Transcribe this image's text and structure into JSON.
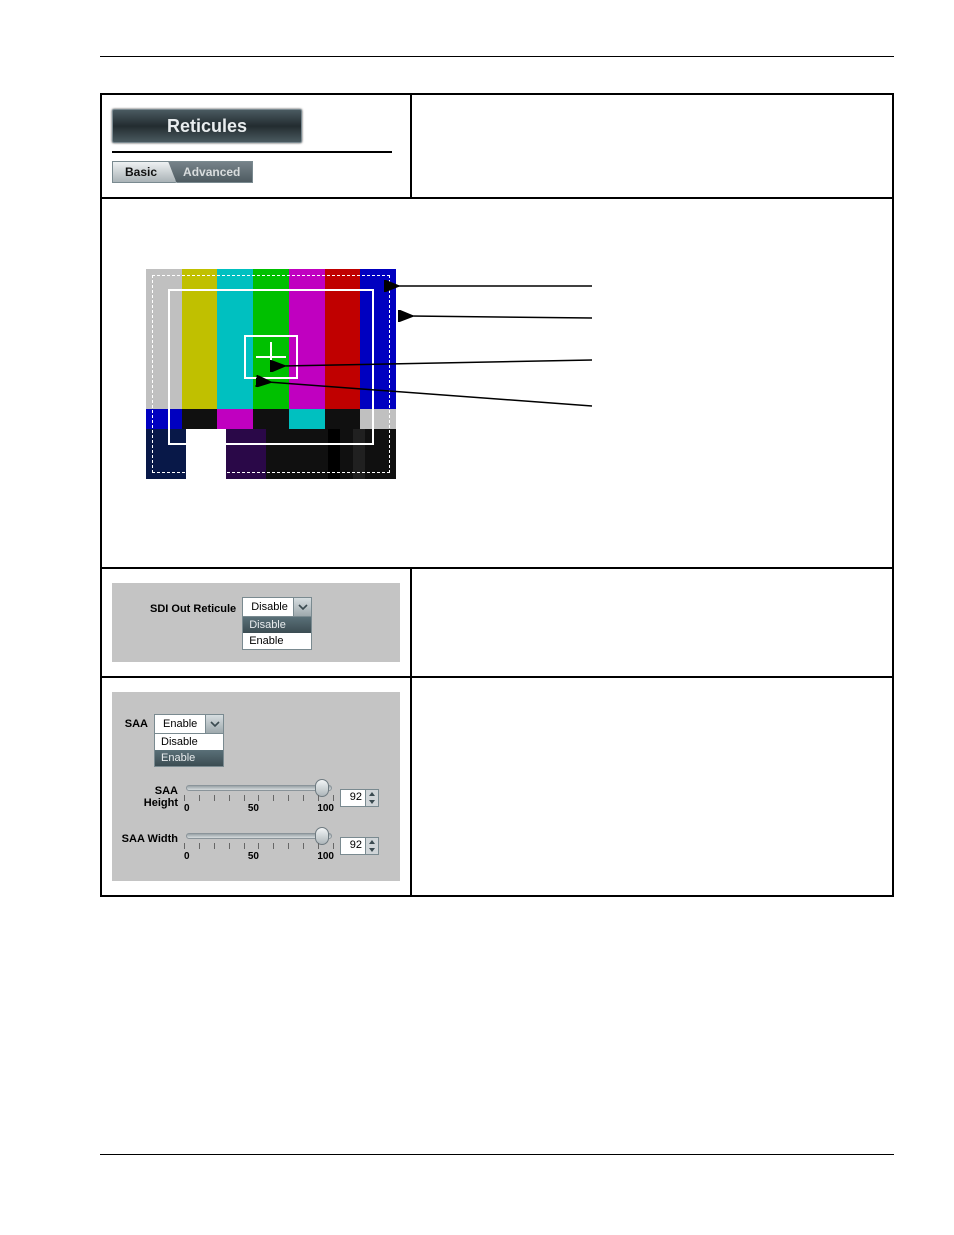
{
  "row1": {
    "title": "Reticules",
    "tab_basic": "Basic",
    "tab_advanced": "Advanced"
  },
  "row3": {
    "label": "SDI Out Reticule",
    "selected": "Disable",
    "options": [
      "Disable",
      "Enable"
    ]
  },
  "row4": {
    "saa_label": "SAA",
    "saa_selected": "Enable",
    "saa_options": [
      "Disable",
      "Enable"
    ],
    "height_label": "SAA Height",
    "height_value": "92",
    "width_label": "SAA Width",
    "width_value": "92",
    "ticks": [
      "0",
      "50",
      "100"
    ]
  }
}
